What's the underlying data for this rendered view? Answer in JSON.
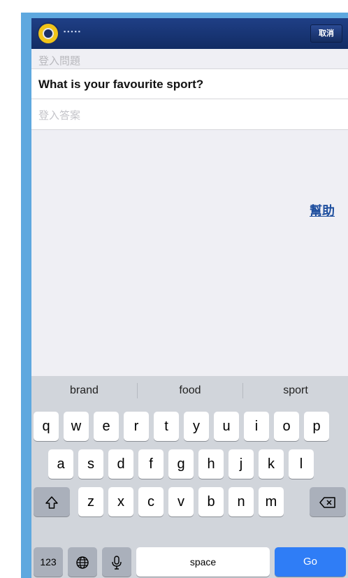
{
  "header": {
    "logo_icon": "logo-emblem-icon",
    "brand_text": "▪▪▪▪▪",
    "cancel_label": "取消"
  },
  "form": {
    "question_label": "登入問題",
    "question_text": "What is your favourite sport?",
    "answer_placeholder": "登入答案",
    "answer_value": "",
    "help_link": "幫助"
  },
  "keyboard": {
    "suggestions": [
      "brand",
      "food",
      "sport"
    ],
    "row1": [
      "q",
      "w",
      "e",
      "r",
      "t",
      "y",
      "u",
      "i",
      "o",
      "p"
    ],
    "row2": [
      "a",
      "s",
      "d",
      "f",
      "g",
      "h",
      "j",
      "k",
      "l"
    ],
    "row3": [
      "z",
      "x",
      "c",
      "v",
      "b",
      "n",
      "m"
    ],
    "numbers_label": "123",
    "space_label": "space",
    "go_label": "Go",
    "icons": {
      "shift": "shift-icon",
      "delete": "backspace-icon",
      "globe": "globe-icon",
      "mic": "microphone-icon"
    },
    "colors": {
      "go_key": "#2f7df6",
      "nav_bar": "#1a3575"
    }
  }
}
